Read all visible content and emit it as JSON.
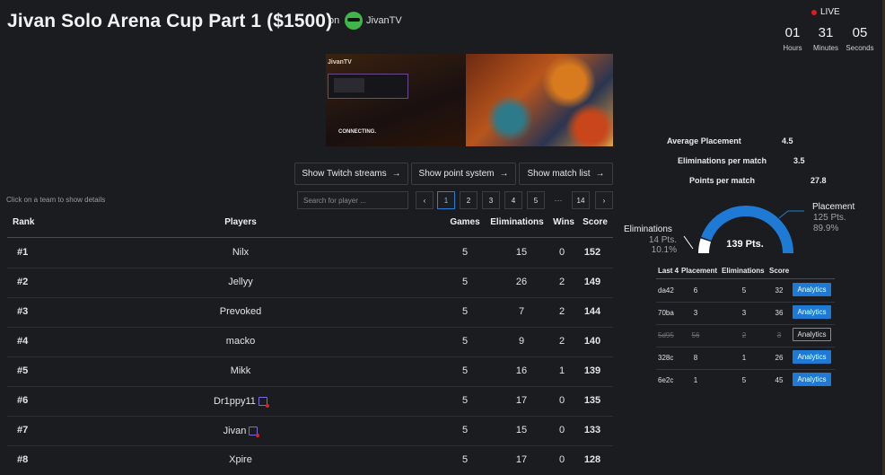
{
  "header": {
    "title": "Jivan Solo Arena Cup Part 1 ($1500)",
    "on_label": "on",
    "channel": "JivanTV",
    "live_label": "LIVE",
    "countdown": [
      {
        "value": "01",
        "label": "Hours"
      },
      {
        "value": "31",
        "label": "Minutes"
      },
      {
        "value": "05",
        "label": "Seconds"
      }
    ]
  },
  "stream": {
    "connecting_label": "CONNECTING.",
    "overlay_tag": "JivanTV"
  },
  "buttons": {
    "twitch": "Show Twitch streams",
    "points": "Show point system",
    "matches": "Show match list"
  },
  "hint": "Click on a team to show details",
  "search": {
    "placeholder": "Search for player ...",
    "value": ""
  },
  "pagination": {
    "prev": "‹",
    "pages": [
      "1",
      "2",
      "3",
      "4",
      "5"
    ],
    "active": "1",
    "ellipsis": "···",
    "last": "14",
    "next": "›"
  },
  "table": {
    "headers": {
      "rank": "Rank",
      "players": "Players",
      "games": "Games",
      "eliminations": "Eliminations",
      "wins": "Wins",
      "score": "Score"
    },
    "rows": [
      {
        "rank": "#1",
        "player": "Nilx",
        "games": "5",
        "eliminations": "15",
        "wins": "0",
        "score": "152",
        "badge": false
      },
      {
        "rank": "#2",
        "player": "Jellyy",
        "games": "5",
        "eliminations": "26",
        "wins": "2",
        "score": "149",
        "badge": false
      },
      {
        "rank": "#3",
        "player": "Prevoked",
        "games": "5",
        "eliminations": "7",
        "wins": "2",
        "score": "144",
        "badge": false
      },
      {
        "rank": "#4",
        "player": "macko",
        "games": "5",
        "eliminations": "9",
        "wins": "2",
        "score": "140",
        "badge": false
      },
      {
        "rank": "#5",
        "player": "Mikk",
        "games": "5",
        "eliminations": "16",
        "wins": "1",
        "score": "139",
        "badge": false
      },
      {
        "rank": "#6",
        "player": "Dr1ppy11",
        "games": "5",
        "eliminations": "17",
        "wins": "0",
        "score": "135",
        "badge": true
      },
      {
        "rank": "#7",
        "player": "Jivan",
        "games": "5",
        "eliminations": "15",
        "wins": "0",
        "score": "133",
        "badge": true
      },
      {
        "rank": "#8",
        "player": "Xpire",
        "games": "5",
        "eliminations": "17",
        "wins": "0",
        "score": "128",
        "badge": false
      }
    ]
  },
  "stats": {
    "avg_placement_label": "Average Placement",
    "avg_placement": "4.5",
    "elims_per_match_label": "Eliminations per match",
    "elims_per_match": "3.5",
    "points_per_match_label": "Points per match",
    "points_per_match": "27.8"
  },
  "gauge": {
    "total": "139 Pts.",
    "eliminations_label": "Eliminations",
    "eliminations_pts": "14 Pts.",
    "eliminations_pct": "10.1%",
    "placement_label": "Placement",
    "placement_pts": "125 Pts.",
    "placement_pct": "89.9%",
    "placement_fraction": 0.899,
    "colors": {
      "placement": "#1f7ad6",
      "eliminations": "#ffffff"
    }
  },
  "last4": {
    "headers": {
      "id": "Last 4",
      "placement": "Placement",
      "eliminations": "Eliminations",
      "score": "Score"
    },
    "button_label": "Analytics",
    "rows": [
      {
        "id": "da42",
        "placement": "6",
        "eliminations": "5",
        "score": "32",
        "struck": false
      },
      {
        "id": "70ba",
        "placement": "3",
        "eliminations": "3",
        "score": "36",
        "struck": false
      },
      {
        "id": "5d95",
        "placement": "56",
        "eliminations": "2",
        "score": "3",
        "struck": true
      },
      {
        "id": "328c",
        "placement": "8",
        "eliminations": "1",
        "score": "26",
        "struck": false
      },
      {
        "id": "6e2c",
        "placement": "1",
        "eliminations": "5",
        "score": "45",
        "struck": false
      }
    ]
  }
}
